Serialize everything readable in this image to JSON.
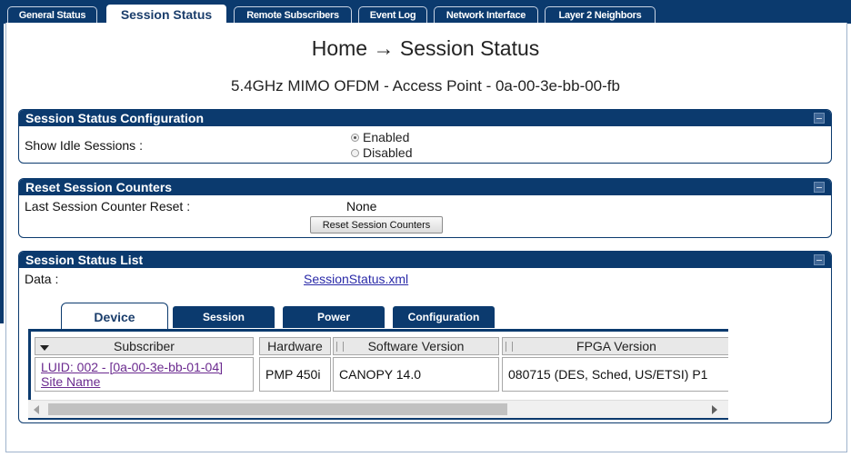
{
  "top_tabs": [
    {
      "label": "General Status",
      "active": false
    },
    {
      "label": "Session Status",
      "active": true
    },
    {
      "label": "Remote Subscribers",
      "active": false
    },
    {
      "label": "Event Log",
      "active": false
    },
    {
      "label": "Network Interface",
      "active": false
    },
    {
      "label": "Layer 2 Neighbors",
      "active": false
    }
  ],
  "page": {
    "title": "Home → Session Status",
    "device_title": "5.4GHz MIMO OFDM - Access Point - 0a-00-3e-bb-00-fb"
  },
  "config_panel": {
    "header": "Session Status Configuration",
    "show_idle_label": "Show Idle Sessions :",
    "options": [
      {
        "label": "Enabled",
        "selected": true
      },
      {
        "label": "Disabled",
        "selected": false
      }
    ]
  },
  "reset_panel": {
    "header": "Reset Session Counters",
    "last_reset_label": "Last Session Counter Reset :",
    "last_reset_value": "None",
    "button_label": "Reset Session Counters"
  },
  "list_panel": {
    "header": "Session Status List",
    "data_label": "Data :",
    "data_link": "SessionStatus.xml",
    "subtabs": [
      {
        "label": "Device",
        "active": true
      },
      {
        "label": "Session",
        "active": false
      },
      {
        "label": "Power",
        "active": false
      },
      {
        "label": "Configuration",
        "active": false
      }
    ],
    "columns": [
      "Subscriber",
      "Hardware",
      "Software Version",
      "FPGA Version"
    ],
    "rows": [
      {
        "subscriber_luid": "LUID: 002 - [0a-00-3e-bb-01-04]",
        "subscriber_site": "Site Name",
        "hardware": "PMP 450i",
        "software": "CANOPY 14.0",
        "fpga": "080715 (DES, Sched, US/ETSI) P1"
      }
    ]
  },
  "colors": {
    "brand_navy": "#0b3a6e",
    "link": "#2a2aa8"
  }
}
